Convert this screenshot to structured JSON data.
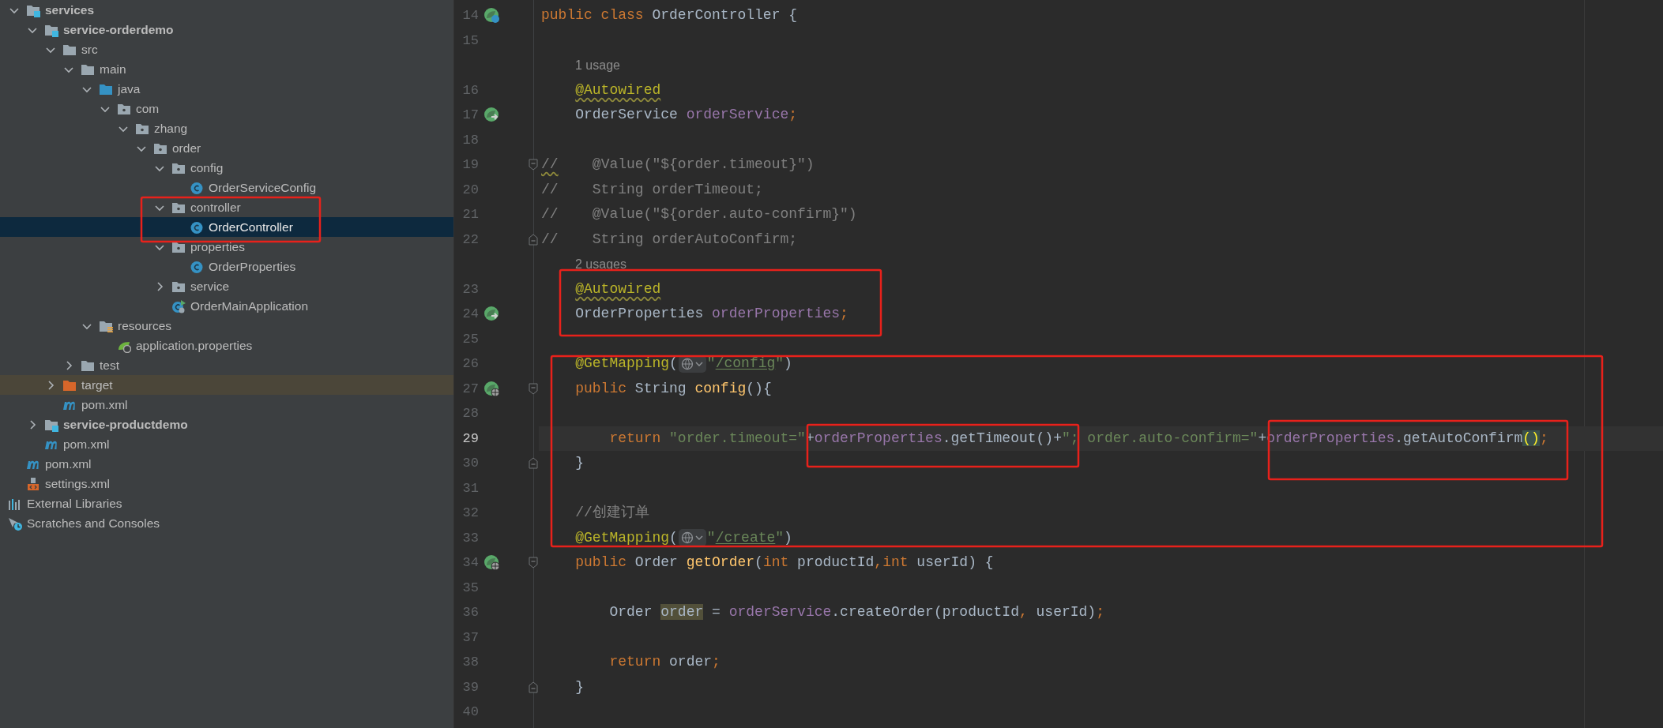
{
  "project_tree": [
    {
      "label": "services",
      "kind": "module",
      "expanded": true,
      "selected": false,
      "children": [
        {
          "label": "service-orderdemo",
          "kind": "module",
          "expanded": true,
          "selected": false,
          "children": [
            {
              "label": "src",
              "kind": "folder",
              "expanded": true,
              "selected": false,
              "children": [
                {
                  "label": "main",
                  "kind": "folder",
                  "expanded": true,
                  "selected": false,
                  "children": [
                    {
                      "label": "java",
                      "kind": "source_root",
                      "expanded": true,
                      "selected": false,
                      "children": [
                        {
                          "label": "com",
                          "kind": "package",
                          "expanded": true,
                          "selected": false,
                          "children": [
                            {
                              "label": "zhang",
                              "kind": "package",
                              "expanded": true,
                              "selected": false,
                              "children": [
                                {
                                  "label": "order",
                                  "kind": "package",
                                  "expanded": true,
                                  "selected": false,
                                  "children": [
                                    {
                                      "label": "config",
                                      "kind": "package",
                                      "expanded": true,
                                      "selected": false,
                                      "children": [
                                        {
                                          "label": "OrderServiceConfig",
                                          "kind": "class",
                                          "selected": false
                                        }
                                      ]
                                    },
                                    {
                                      "label": "controller",
                                      "kind": "package",
                                      "expanded": true,
                                      "selected": false,
                                      "children": [
                                        {
                                          "label": "OrderController",
                                          "kind": "class",
                                          "selected": true
                                        }
                                      ]
                                    },
                                    {
                                      "label": "properties",
                                      "kind": "package",
                                      "expanded": true,
                                      "selected": false,
                                      "children": [
                                        {
                                          "label": "OrderProperties",
                                          "kind": "class",
                                          "selected": false
                                        }
                                      ]
                                    },
                                    {
                                      "label": "service",
                                      "kind": "package",
                                      "expanded": false,
                                      "selected": false
                                    },
                                    {
                                      "label": "OrderMainApplication",
                                      "kind": "app_class",
                                      "selected": false
                                    }
                                  ]
                                }
                              ]
                            }
                          ]
                        }
                      ]
                    },
                    {
                      "label": "resources",
                      "kind": "resources_root",
                      "expanded": true,
                      "selected": false,
                      "children": [
                        {
                          "label": "application.properties",
                          "kind": "spring_properties",
                          "selected": false
                        }
                      ]
                    }
                  ]
                },
                {
                  "label": "test",
                  "kind": "folder",
                  "expanded": false,
                  "selected": false
                }
              ]
            },
            {
              "label": "target",
              "kind": "excluded_folder",
              "expanded": false,
              "selected": false
            },
            {
              "label": "pom.xml",
              "kind": "maven",
              "selected": false
            }
          ]
        },
        {
          "label": "service-productdemo",
          "kind": "module",
          "expanded": false,
          "selected": false
        },
        {
          "label": "pom.xml",
          "kind": "maven",
          "selected": false
        }
      ]
    },
    {
      "label": "pom.xml",
      "kind": "maven",
      "selected": false
    },
    {
      "label": "settings.xml",
      "kind": "xml_settings",
      "selected": false
    },
    {
      "label": "External Libraries",
      "kind": "libraries",
      "selected": false
    },
    {
      "label": "Scratches and Consoles",
      "kind": "scratches",
      "selected": false
    }
  ],
  "editor": {
    "rows": [
      {
        "kind": "code",
        "number": "14",
        "gutter": {
          "kind": "bean"
        },
        "current": false,
        "tokens": [
          {
            "kind": "kw",
            "text": "public class "
          },
          {
            "kind": "plain",
            "text": "OrderController {"
          }
        ]
      },
      {
        "kind": "code",
        "number": "15",
        "current": false,
        "tokens": []
      },
      {
        "kind": "hint",
        "text": "1 usage"
      },
      {
        "kind": "code",
        "number": "16",
        "current": false,
        "tokens": [
          {
            "kind": "annotation_warn",
            "text": "    @Autowired"
          }
        ]
      },
      {
        "kind": "code",
        "number": "17",
        "gutter": {
          "kind": "injected"
        },
        "current": false,
        "tokens": [
          {
            "kind": "plain",
            "text": "    OrderService "
          },
          {
            "kind": "field",
            "text": "orderService"
          },
          {
            "kind": "kw",
            "text": ";"
          }
        ]
      },
      {
        "kind": "code",
        "number": "18",
        "current": false,
        "tokens": []
      },
      {
        "kind": "code",
        "number": "19",
        "fold": {
          "kind": "start"
        },
        "current": false,
        "tokens": [
          {
            "kind": "comment_warn",
            "text": "//"
          },
          {
            "kind": "comment",
            "text": "    @Value(\"${order.timeout}\")"
          }
        ]
      },
      {
        "kind": "code",
        "number": "20",
        "current": false,
        "tokens": [
          {
            "kind": "comment",
            "text": "//    String orderTimeout;"
          }
        ]
      },
      {
        "kind": "code",
        "number": "21",
        "current": false,
        "tokens": [
          {
            "kind": "comment",
            "text": "//    @Value(\"${order.auto-confirm}\")"
          }
        ]
      },
      {
        "kind": "code",
        "number": "22",
        "fold": {
          "kind": "end"
        },
        "current": false,
        "tokens": [
          {
            "kind": "comment",
            "text": "//    String orderAutoConfirm;"
          }
        ]
      },
      {
        "kind": "hint",
        "text": "2 usages"
      },
      {
        "kind": "code",
        "number": "23",
        "current": false,
        "tokens": [
          {
            "kind": "annotation_warn",
            "text": "    @Autowired"
          }
        ]
      },
      {
        "kind": "code",
        "number": "24",
        "gutter": {
          "kind": "injected"
        },
        "current": false,
        "tokens": [
          {
            "kind": "plain",
            "text": "    OrderProperties "
          },
          {
            "kind": "field",
            "text": "orderProperties"
          },
          {
            "kind": "kw",
            "text": ";"
          }
        ]
      },
      {
        "kind": "code",
        "number": "25",
        "current": false,
        "tokens": []
      },
      {
        "kind": "code",
        "number": "26",
        "current": false,
        "tokens": [
          {
            "kind": "annotation",
            "text": "    @GetMapping"
          },
          {
            "kind": "plain",
            "text": "("
          },
          {
            "kind": "inlay"
          },
          {
            "kind": "str",
            "text": "\""
          },
          {
            "kind": "link",
            "text": "/config"
          },
          {
            "kind": "str",
            "text": "\""
          },
          {
            "kind": "plain",
            "text": ")"
          }
        ]
      },
      {
        "kind": "code",
        "number": "27",
        "gutter": {
          "kind": "endpoint"
        },
        "fold": {
          "kind": "start"
        },
        "current": false,
        "tokens": [
          {
            "kind": "kw",
            "text": "    public "
          },
          {
            "kind": "plain",
            "text": "String "
          },
          {
            "kind": "method",
            "text": "config"
          },
          {
            "kind": "plain",
            "text": "(){"
          }
        ]
      },
      {
        "kind": "code",
        "number": "28",
        "current": false,
        "tokens": []
      },
      {
        "kind": "code",
        "number": "29",
        "current": true,
        "tokens": [
          {
            "kind": "kw",
            "text": "        return "
          },
          {
            "kind": "str",
            "text": "\"order.timeout=\""
          },
          {
            "kind": "plain",
            "text": "+"
          },
          {
            "kind": "field",
            "text": "orderProperties"
          },
          {
            "kind": "plain",
            "text": ".getTimeout()+"
          },
          {
            "kind": "str",
            "text": "\"; order.auto-confirm=\""
          },
          {
            "kind": "plain",
            "text": "+"
          },
          {
            "kind": "field",
            "text": "orderProperties"
          },
          {
            "kind": "plain",
            "text": ".getAutoConfirm"
          },
          {
            "kind": "brace_match",
            "text": "()"
          },
          {
            "kind": "kw",
            "text": ";"
          }
        ]
      },
      {
        "kind": "code",
        "number": "30",
        "fold": {
          "kind": "end"
        },
        "current": false,
        "tokens": [
          {
            "kind": "plain",
            "text": "    }"
          }
        ]
      },
      {
        "kind": "code",
        "number": "31",
        "current": false,
        "tokens": []
      },
      {
        "kind": "code",
        "number": "32",
        "current": false,
        "tokens": [
          {
            "kind": "comment",
            "text": "    //创建订单"
          }
        ]
      },
      {
        "kind": "code",
        "number": "33",
        "current": false,
        "tokens": [
          {
            "kind": "annotation",
            "text": "    @GetMapping"
          },
          {
            "kind": "plain",
            "text": "("
          },
          {
            "kind": "inlay"
          },
          {
            "kind": "str",
            "text": "\""
          },
          {
            "kind": "link",
            "text": "/create"
          },
          {
            "kind": "str",
            "text": "\""
          },
          {
            "kind": "plain",
            "text": ")"
          }
        ]
      },
      {
        "kind": "code",
        "number": "34",
        "gutter": {
          "kind": "endpoint"
        },
        "fold": {
          "kind": "start"
        },
        "current": false,
        "tokens": [
          {
            "kind": "kw",
            "text": "    public "
          },
          {
            "kind": "plain",
            "text": "Order "
          },
          {
            "kind": "method",
            "text": "getOrder"
          },
          {
            "kind": "plain",
            "text": "("
          },
          {
            "kind": "kw",
            "text": "int "
          },
          {
            "kind": "plain",
            "text": "productId"
          },
          {
            "kind": "kw",
            "text": ","
          },
          {
            "kind": "kw",
            "text": "int "
          },
          {
            "kind": "plain",
            "text": "userId) {"
          }
        ]
      },
      {
        "kind": "code",
        "number": "35",
        "current": false,
        "tokens": []
      },
      {
        "kind": "code",
        "number": "36",
        "current": false,
        "tokens": [
          {
            "kind": "plain",
            "text": "        Order "
          },
          {
            "kind": "var_highlight",
            "text": "order"
          },
          {
            "kind": "plain",
            "text": " = "
          },
          {
            "kind": "field",
            "text": "orderService"
          },
          {
            "kind": "plain",
            "text": ".createOrder(productId"
          },
          {
            "kind": "kw",
            "text": ", "
          },
          {
            "kind": "plain",
            "text": "userId)"
          },
          {
            "kind": "kw",
            "text": ";"
          }
        ]
      },
      {
        "kind": "code",
        "number": "37",
        "current": false,
        "tokens": []
      },
      {
        "kind": "code",
        "number": "38",
        "current": false,
        "tokens": [
          {
            "kind": "kw",
            "text": "        return "
          },
          {
            "kind": "plain",
            "text": "order"
          },
          {
            "kind": "kw",
            "text": ";"
          }
        ]
      },
      {
        "kind": "code",
        "number": "39",
        "fold": {
          "kind": "end"
        },
        "current": false,
        "tokens": [
          {
            "kind": "plain",
            "text": "    }"
          }
        ]
      },
      {
        "kind": "code",
        "number": "40",
        "current": false,
        "tokens": []
      }
    ]
  }
}
